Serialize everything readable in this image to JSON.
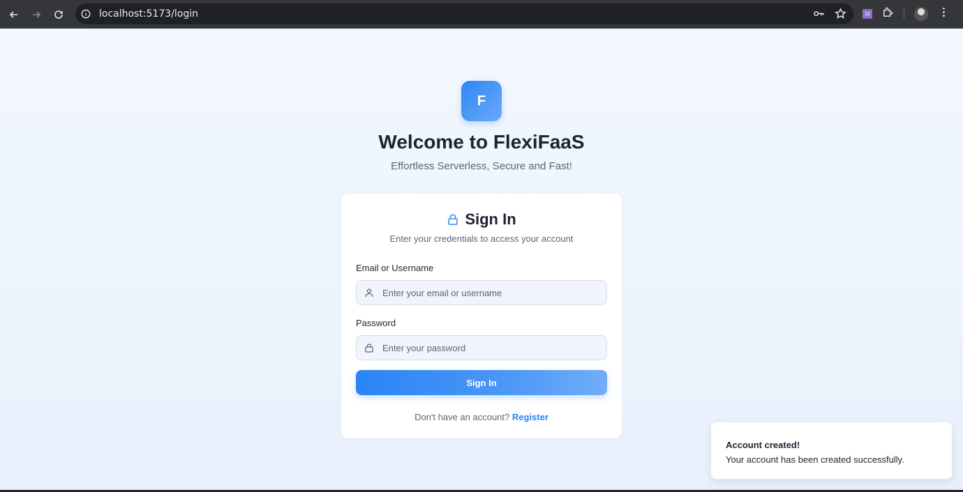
{
  "browser": {
    "url": "localhost:5173/login",
    "extension_label": "M"
  },
  "header": {
    "logo_letter": "F",
    "title": "Welcome to FlexiFaaS",
    "subtitle": "Effortless Serverless, Secure and Fast!"
  },
  "card": {
    "title": "Sign In",
    "subtitle": "Enter your credentials to access your account",
    "email_label": "Email or Username",
    "email_placeholder": "Enter your email or username",
    "password_label": "Password",
    "password_placeholder": "Enter your password",
    "submit_label": "Sign In",
    "register_prompt": "Don't have an account?",
    "register_link": "Register"
  },
  "toast": {
    "title": "Account created!",
    "message": "Your account has been created successfully."
  },
  "colors": {
    "accent": "#2f86f6",
    "text_dark": "#1c2431",
    "text_muted": "#5a6577"
  }
}
